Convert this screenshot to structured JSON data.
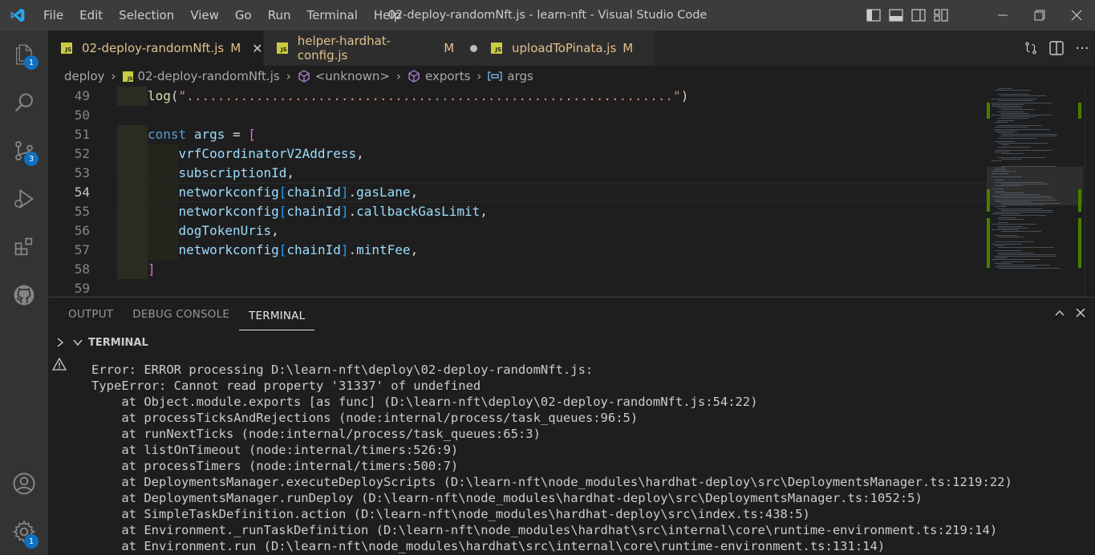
{
  "titlebar": {
    "menu": [
      "File",
      "Edit",
      "Selection",
      "View",
      "Go",
      "Run",
      "Terminal",
      "Help"
    ],
    "title": "02-deploy-randomNft.js - learn-nft - Visual Studio Code"
  },
  "activity": {
    "explorer_badge": "1",
    "scm_badge": "3",
    "settings_badge": "1"
  },
  "tabs": [
    {
      "label": "02-deploy-randomNft.js",
      "status": "M",
      "active": true
    },
    {
      "label": "helper-hardhat-config.js",
      "status": "M",
      "active": false
    },
    {
      "label": "uploadToPinata.js",
      "status": "M",
      "active": false
    }
  ],
  "breadcrumb": {
    "folder": "deploy",
    "file": "02-deploy-randomNft.js",
    "sym1": "<unknown>",
    "sym2": "exports",
    "sym3": "args"
  },
  "editor": {
    "lines": [
      {
        "num": "49",
        "parts": [
          [
            "fn",
            "log"
          ],
          [
            "plain",
            "("
          ],
          [
            "str",
            "\"...............................................................\""
          ],
          [
            "plain",
            ")"
          ]
        ]
      },
      {
        "num": "50",
        "parts": []
      },
      {
        "num": "51",
        "parts": [
          [
            "kw",
            "const"
          ],
          [
            "plain",
            " "
          ],
          [
            "var",
            "args"
          ],
          [
            "plain",
            " = "
          ],
          [
            "br",
            "["
          ]
        ]
      },
      {
        "num": "52",
        "parts": [
          [
            "plain",
            "    "
          ],
          [
            "var",
            "vrfCoordinatorV2Address"
          ],
          [
            "plain",
            ","
          ]
        ]
      },
      {
        "num": "53",
        "parts": [
          [
            "plain",
            "    "
          ],
          [
            "var",
            "subscriptionId"
          ],
          [
            "plain",
            ","
          ]
        ]
      },
      {
        "num": "54",
        "parts": [
          [
            "plain",
            "    "
          ],
          [
            "var",
            "networkconfig"
          ],
          [
            "br2",
            "["
          ],
          [
            "var",
            "chainId"
          ],
          [
            "br2",
            "]"
          ],
          [
            "plain",
            "."
          ],
          [
            "var",
            "gasLane"
          ],
          [
            "plain",
            ","
          ]
        ]
      },
      {
        "num": "55",
        "parts": [
          [
            "plain",
            "    "
          ],
          [
            "var",
            "networkconfig"
          ],
          [
            "br2",
            "["
          ],
          [
            "var",
            "chainId"
          ],
          [
            "br2",
            "]"
          ],
          [
            "plain",
            "."
          ],
          [
            "var",
            "callbackGasLimit"
          ],
          [
            "plain",
            ","
          ]
        ]
      },
      {
        "num": "56",
        "parts": [
          [
            "plain",
            "    "
          ],
          [
            "var",
            "dogTokenUris"
          ],
          [
            "plain",
            ","
          ]
        ]
      },
      {
        "num": "57",
        "parts": [
          [
            "plain",
            "    "
          ],
          [
            "var",
            "networkconfig"
          ],
          [
            "br2",
            "["
          ],
          [
            "var",
            "chainId"
          ],
          [
            "br2",
            "]"
          ],
          [
            "plain",
            "."
          ],
          [
            "var",
            "mintFee"
          ],
          [
            "plain",
            ","
          ]
        ]
      },
      {
        "num": "58",
        "parts": [
          [
            "br",
            "]"
          ]
        ]
      },
      {
        "num": "59",
        "parts": []
      }
    ],
    "current_line": "54"
  },
  "panel": {
    "tabs": [
      "OUTPUT",
      "DEBUG CONSOLE",
      "TERMINAL"
    ],
    "active_tab": "TERMINAL",
    "section_title": "TERMINAL",
    "output": [
      "Error: ERROR processing D:\\learn-nft\\deploy\\02-deploy-randomNft.js:",
      "TypeError: Cannot read property '31337' of undefined",
      "    at Object.module.exports [as func] (D:\\learn-nft\\deploy\\02-deploy-randomNft.js:54:22)",
      "    at processTicksAndRejections (node:internal/process/task_queues:96:5)",
      "    at runNextTicks (node:internal/process/task_queues:65:3)",
      "    at listOnTimeout (node:internal/timers:526:9)",
      "    at processTimers (node:internal/timers:500:7)",
      "    at DeploymentsManager.executeDeployScripts (D:\\learn-nft\\node_modules\\hardhat-deploy\\src\\DeploymentsManager.ts:1219:22)",
      "    at DeploymentsManager.runDeploy (D:\\learn-nft\\node_modules\\hardhat-deploy\\src\\DeploymentsManager.ts:1052:5)",
      "    at SimpleTaskDefinition.action (D:\\learn-nft\\node_modules\\hardhat-deploy\\src\\index.ts:438:5)",
      "    at Environment._runTaskDefinition (D:\\learn-nft\\node_modules\\hardhat\\src\\internal\\core\\runtime-environment.ts:219:14)",
      "    at Environment.run (D:\\learn-nft\\node_modules\\hardhat\\src\\internal\\core\\runtime-environment.ts:131:14)"
    ]
  }
}
